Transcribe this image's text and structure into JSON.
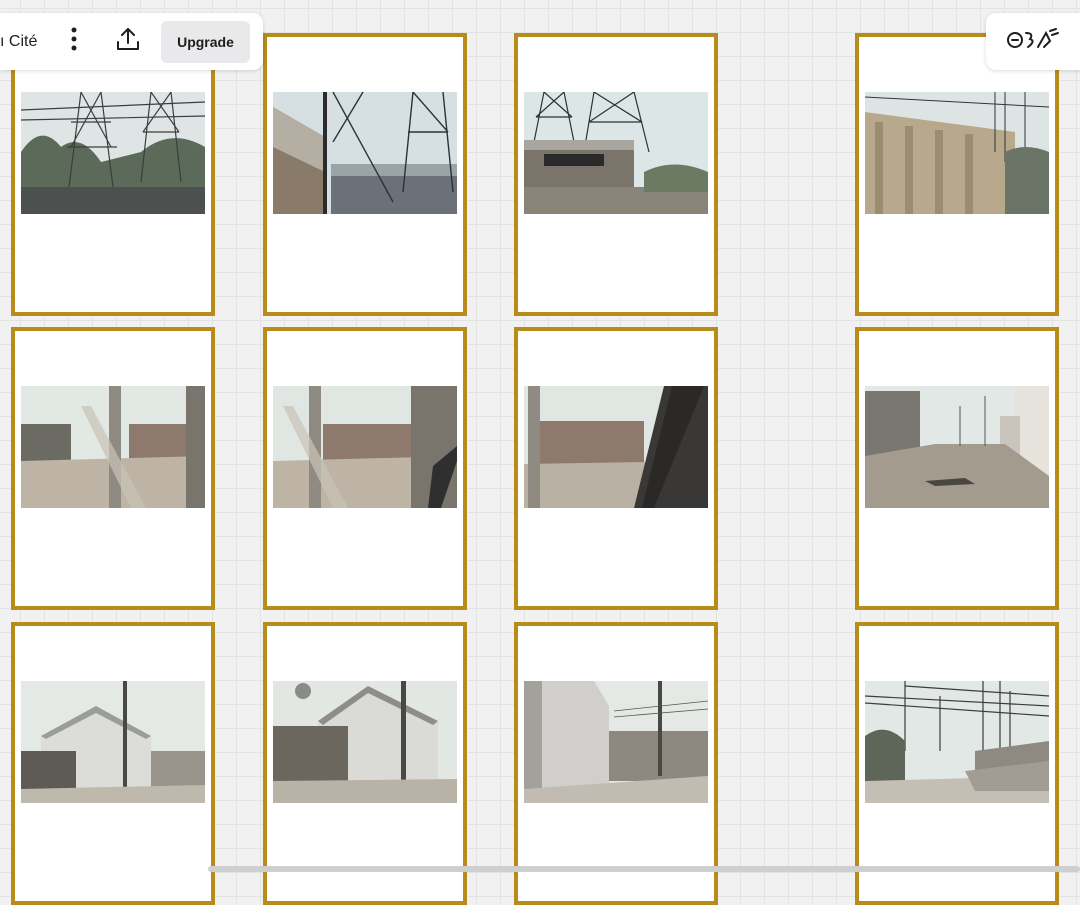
{
  "toolbar": {
    "doc_title": "ı Cité",
    "more_icon": "more-vertical-icon",
    "share_icon": "upload-icon",
    "upgrade_label": "Upgrade"
  },
  "logo": {
    "icon": "brand-logo-icon"
  },
  "cards": [
    {
      "row": 1,
      "col": 1,
      "scene": "pylons-trees"
    },
    {
      "row": 1,
      "col": 2,
      "scene": "pylons-building"
    },
    {
      "row": 1,
      "col": 3,
      "scene": "pylons-factory"
    },
    {
      "row": 1,
      "col": 4,
      "scene": "industrial-wall"
    },
    {
      "row": 2,
      "col": 1,
      "scene": "dirt-road-blur"
    },
    {
      "row": 2,
      "col": 2,
      "scene": "dirt-road-blur"
    },
    {
      "row": 2,
      "col": 3,
      "scene": "window-frame-blur"
    },
    {
      "row": 2,
      "col": 4,
      "scene": "alley-road"
    },
    {
      "row": 3,
      "col": 1,
      "scene": "white-shed"
    },
    {
      "row": 3,
      "col": 2,
      "scene": "white-shed-pole"
    },
    {
      "row": 3,
      "col": 3,
      "scene": "shed-street"
    },
    {
      "row": 3,
      "col": 4,
      "scene": "power-lines-street"
    }
  ],
  "colors": {
    "frame": "#b88c1b",
    "canvas": "#f1f1f1",
    "sky": "#dfe7e4"
  }
}
